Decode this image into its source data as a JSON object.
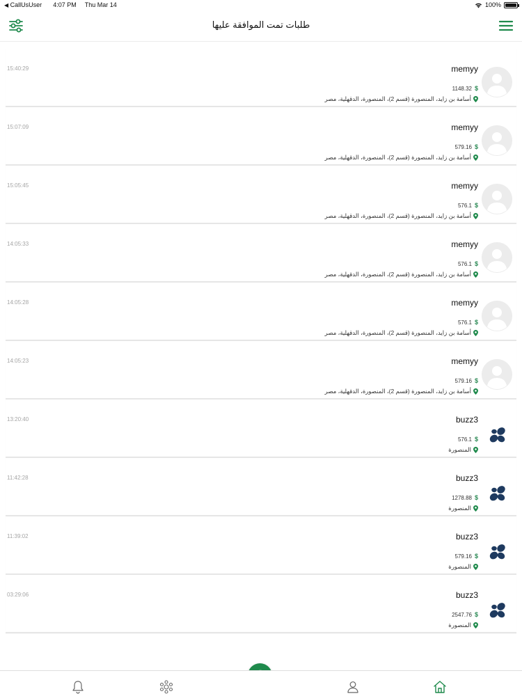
{
  "status_bar": {
    "carrier": "CallUsUser",
    "time": "4:07 PM",
    "date": "Thu Mar 14",
    "battery": "100%"
  },
  "header": {
    "title": "طلبات تمت الموافقة عليها",
    "filter_icon": "sliders-icon",
    "menu_icon": "hamburger-menu-icon"
  },
  "colors": {
    "accent": "#1f8a4c",
    "logo": "#1e3a5f",
    "muted": "#a5a5a5"
  },
  "orders": [
    {
      "time": "15:40:29",
      "name": "memyy",
      "price": "1148.32",
      "currency": "$",
      "address": "أسامة بن زايد، المنصورة (قسم 2)، المنصورة، الدقهلية، مصر",
      "avatar": "placeholder"
    },
    {
      "time": "15:07:09",
      "name": "memyy",
      "price": "579.16",
      "currency": "$",
      "address": "أسامة بن زايد، المنصورة (قسم 2)، المنصورة، الدقهلية، مصر",
      "avatar": "placeholder"
    },
    {
      "time": "15:05:45",
      "name": "memyy",
      "price": "576.1",
      "currency": "$",
      "address": "أسامة بن زايد، المنصورة (قسم 2)، المنصورة، الدقهلية، مصر",
      "avatar": "placeholder"
    },
    {
      "time": "14:05:33",
      "name": "memyy",
      "price": "576.1",
      "currency": "$",
      "address": "أسامة بن زايد، المنصورة (قسم 2)، المنصورة، الدقهلية، مصر",
      "avatar": "placeholder"
    },
    {
      "time": "14:05:28",
      "name": "memyy",
      "price": "576.1",
      "currency": "$",
      "address": "أسامة بن زايد، المنصورة (قسم 2)، المنصورة، الدقهلية، مصر",
      "avatar": "placeholder"
    },
    {
      "time": "14:05:23",
      "name": "memyy",
      "price": "579.16",
      "currency": "$",
      "address": "أسامة بن زايد، المنصورة (قسم 2)، المنصورة، الدقهلية، مصر",
      "avatar": "placeholder"
    },
    {
      "time": "13:20:40",
      "name": "buzz3",
      "price": "576.1",
      "currency": "$",
      "address": "المنصورة",
      "avatar": "logo"
    },
    {
      "time": "11:42:28",
      "name": "buzz3",
      "price": "1278.88",
      "currency": "$",
      "address": "المنصورة",
      "avatar": "logo"
    },
    {
      "time": "11:39:02",
      "name": "buzz3",
      "price": "579.16",
      "currency": "$",
      "address": "المنصورة",
      "avatar": "logo"
    },
    {
      "time": "03:29:06",
      "name": "buzz3",
      "price": "2547.76",
      "currency": "$",
      "address": "المنصورة",
      "avatar": "logo"
    }
  ],
  "bottom_nav": {
    "items": [
      {
        "icon": "bell-icon"
      },
      {
        "icon": "network-icon"
      },
      {
        "icon": "add-icon"
      },
      {
        "icon": "user-icon"
      },
      {
        "icon": "home-icon"
      }
    ]
  }
}
